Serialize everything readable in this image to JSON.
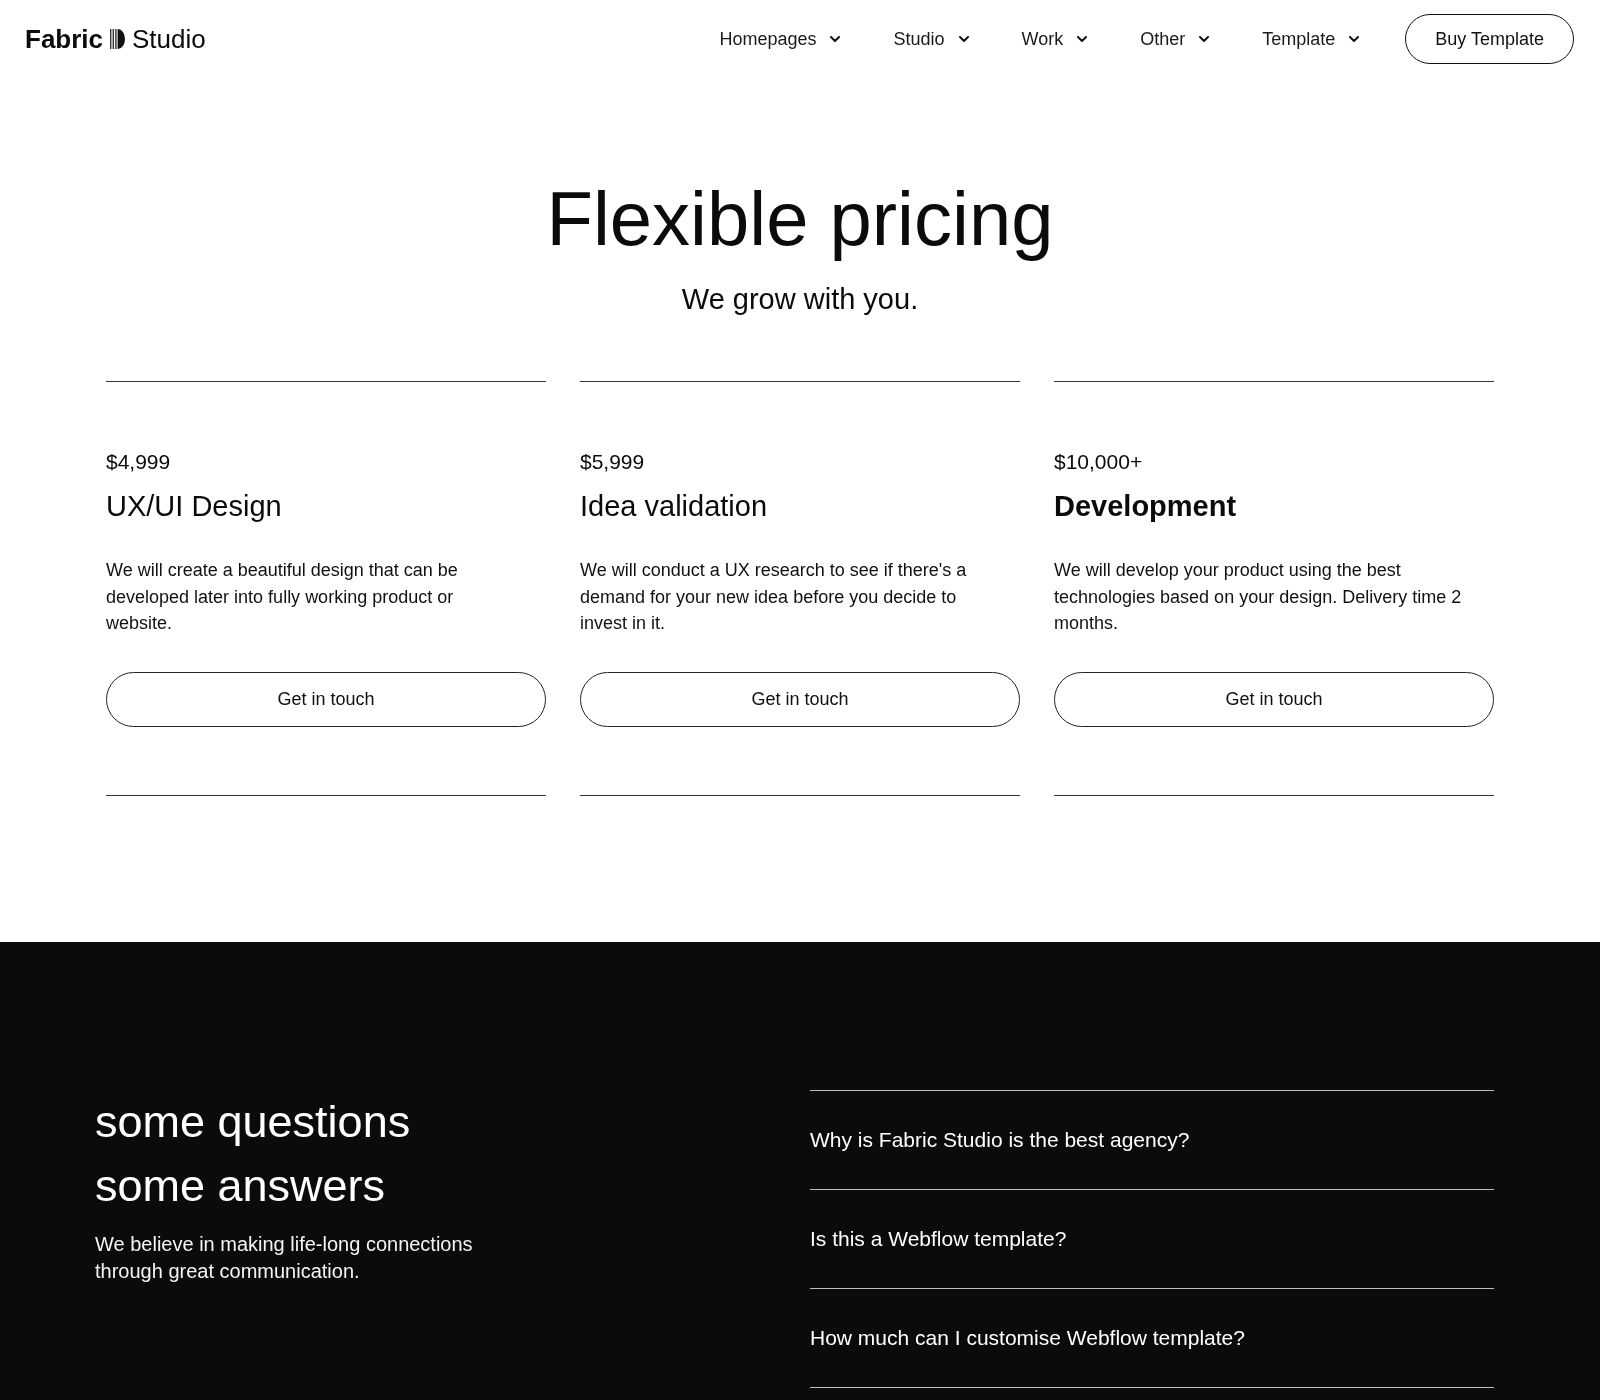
{
  "header": {
    "logo": {
      "bold_word": "Fabric",
      "word": "Studio"
    },
    "nav": [
      {
        "label": "Homepages"
      },
      {
        "label": "Studio"
      },
      {
        "label": "Work"
      },
      {
        "label": "Other"
      },
      {
        "label": "Template"
      }
    ],
    "cta": "Buy Template"
  },
  "pricing": {
    "title": "Flexible pricing",
    "subtitle": "We grow with you.",
    "plans": [
      {
        "price": "$4,999",
        "name": "UX/UI Design",
        "emphasized": false,
        "description": "We will create a beautiful design that can be developed later into fully working product or website.",
        "button": "Get in touch"
      },
      {
        "price": "$5,999",
        "name": "Idea validation",
        "emphasized": false,
        "description": "We will conduct a UX research to see if there's a demand for your new idea before you decide to invest in it.",
        "button": "Get in touch"
      },
      {
        "price": "$10,000+",
        "name": "Development",
        "emphasized": true,
        "description": "We will develop your product using the best technologies based on your design. Delivery time 2 months.",
        "button": "Get in touch"
      }
    ]
  },
  "faq": {
    "heading": "some questions some answers",
    "text": "We believe in making life-long connections through great communication.",
    "questions": [
      "Why is Fabric Studio is the best agency?",
      "Is this a Webflow template?",
      "How much can I customise Webflow template?"
    ]
  }
}
